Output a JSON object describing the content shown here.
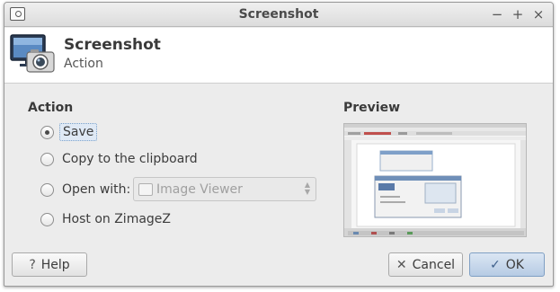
{
  "window": {
    "title": "Screenshot"
  },
  "titlebar_buttons": {
    "minimize": "−",
    "maximize": "+",
    "close": "×"
  },
  "header": {
    "title": "Screenshot",
    "subtitle": "Action"
  },
  "action": {
    "heading": "Action",
    "options": [
      {
        "label": "Save",
        "checked": true
      },
      {
        "label": "Copy to the clipboard",
        "checked": false
      },
      {
        "label": "Open with:",
        "checked": false
      },
      {
        "label": "Host on ZimageZ",
        "checked": false
      }
    ],
    "open_with": {
      "value": "Image Viewer",
      "icon": "image-viewer-icon"
    }
  },
  "preview": {
    "heading": "Preview"
  },
  "buttons": {
    "help": {
      "label": "Help",
      "icon": "question-icon"
    },
    "cancel": {
      "label": "Cancel",
      "icon": "cancel-icon"
    },
    "ok": {
      "label": "OK",
      "icon": "checkmark-icon"
    }
  },
  "colors": {
    "ok_button": "#b6cbe4",
    "focus_highlight": "#dfe9f5"
  }
}
